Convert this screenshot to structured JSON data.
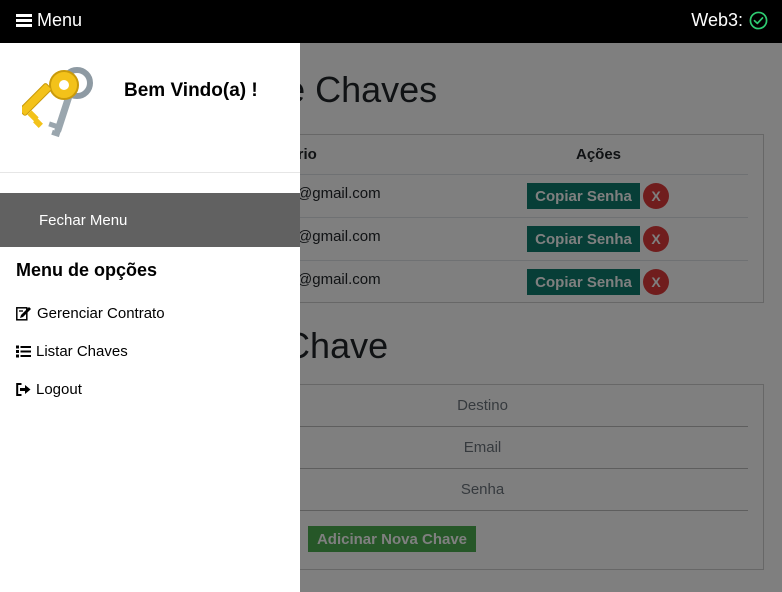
{
  "topbar": {
    "menu_label": "Menu",
    "web3_label": "Web3:",
    "status_color": "#2ecc71"
  },
  "main": {
    "list_title": "Lista de Chaves",
    "table": {
      "col_user": "Usuário",
      "col_actions": "Ações",
      "rows": [
        {
          "email": "@gmail.com",
          "copy_label": "Copiar Senha",
          "delete_label": "X"
        },
        {
          "email": "@gmail.com",
          "copy_label": "Copiar Senha",
          "delete_label": "X"
        },
        {
          "email": "@gmail.com",
          "copy_label": "Copiar Senha",
          "delete_label": "X"
        }
      ]
    },
    "new_title": "Nova Chave",
    "form": {
      "destino_placeholder": "Destino",
      "email_placeholder": "Email",
      "senha_placeholder": "Senha",
      "add_label": "Adicinar Nova Chave"
    }
  },
  "sidebar": {
    "icon": "keys-icon",
    "welcome": "Bem Vindo(a) !",
    "close_label": "Fechar Menu",
    "options_title": "Menu de opções",
    "options": [
      {
        "icon": "edit-icon",
        "label": "Gerenciar Contrato"
      },
      {
        "icon": "list-icon",
        "label": "Listar Chaves"
      },
      {
        "icon": "logout-icon",
        "label": "Logout"
      }
    ]
  },
  "colors": {
    "copy_button": "#0f7d6e",
    "delete_button": "#e03b3b",
    "add_button": "#4caf50",
    "close_menu_bg": "#616161"
  }
}
